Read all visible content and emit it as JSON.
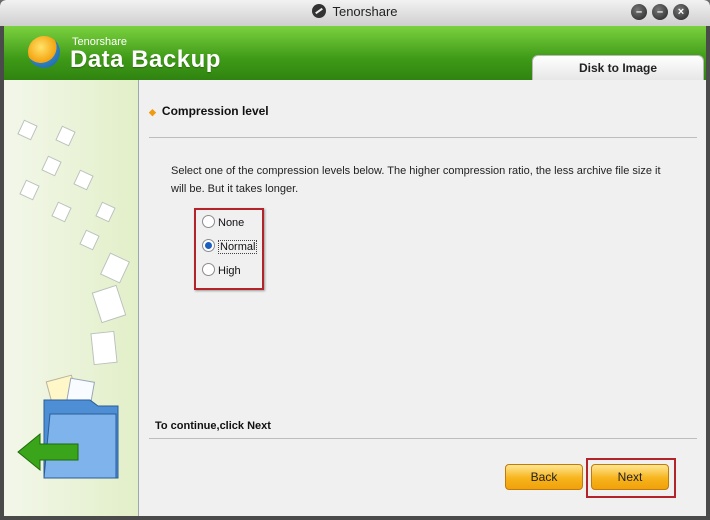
{
  "window": {
    "title": "Tenorshare",
    "controls": [
      {
        "name": "minimize",
        "glyph": "–"
      },
      {
        "name": "maximize",
        "glyph": "–"
      },
      {
        "name": "close",
        "glyph": "×"
      }
    ]
  },
  "header": {
    "vendor": "Tenorshare",
    "product": "Data Backup",
    "tab": "Disk to Image",
    "accent": "#49a11d"
  },
  "content": {
    "section_title": "Compression level",
    "description": "Select one of the compression levels below. The higher compression ratio, the less archive file size it will be. But it takes longer.",
    "options": [
      {
        "label": "None",
        "checked": false
      },
      {
        "label": "Normal",
        "checked": true
      },
      {
        "label": "High",
        "checked": false
      }
    ],
    "continue_hint": "To continue,click Next"
  },
  "buttons": {
    "back": "Back",
    "next": "Next"
  },
  "colors": {
    "highlight_border": "#b3232a",
    "button": "#f7b41c"
  }
}
